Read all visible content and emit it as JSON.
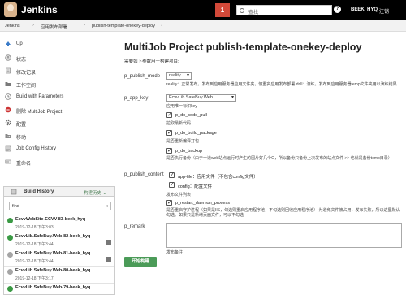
{
  "header": {
    "brand": "Jenkins",
    "notification_count": "1",
    "search_placeholder": "查找",
    "user": "BEEK_HYQ",
    "logout": "注销"
  },
  "breadcrumb": [
    "Jenkins",
    "应用发布部署",
    "publish-template-onekey-deploy"
  ],
  "sidebar": {
    "items": [
      {
        "label": "Up",
        "icon": "up-arrow-icon"
      },
      {
        "label": "状态",
        "icon": "status-icon"
      },
      {
        "label": "修改记录",
        "icon": "changes-icon"
      },
      {
        "label": "工作空间",
        "icon": "folder-icon"
      },
      {
        "label": "Build with Parameters",
        "icon": "build-clock-icon"
      },
      {
        "label": "删除 MultiJob Project",
        "icon": "delete-icon"
      },
      {
        "label": "配置",
        "icon": "gear-icon"
      },
      {
        "label": "移动",
        "icon": "move-icon"
      },
      {
        "label": "Job Config History",
        "icon": "history-icon"
      },
      {
        "label": "重命名",
        "icon": "rename-icon"
      }
    ]
  },
  "build_history": {
    "title": "Build History",
    "trend": "构建历史 ⌄",
    "filter_value": "find",
    "clear": "x",
    "builds": [
      {
        "name": "EcvvWebSite-ECVV-83-beek_hyq",
        "time": "2019-12-18 下午3:03",
        "status": "ok"
      },
      {
        "name": "EcvvLib.SafeBuy.Web-82-beek_hyq",
        "time": "2019-12-18 下午3:44",
        "status": "ok"
      },
      {
        "name": "EcvvLib.SafeBuy.Web-81-beek_hyq",
        "time": "2019-12-18 下午3:44",
        "status": "grey"
      },
      {
        "name": "EcvvLib.SafeBuy.Web-80-beek_hyq",
        "time": "2019-12-18 下午3:17",
        "status": "grey"
      },
      {
        "name": "EcvvLib.SafeBuy.Web-79-beek_hyq",
        "time": "",
        "status": "ok"
      }
    ]
  },
  "main": {
    "title": "MultiJob Project publish-template-onekey-deploy",
    "intro": "需要如下参数用于构建项目:",
    "publish_mode": {
      "label": "p_publish_mode",
      "value": "reality",
      "desc": "reality：正常发布。发布到应用服务器应用文件夹，慎重实应用发布部署 drill：演练。发布到应用服务器temp文件夹用以演练结果"
    },
    "app_key": {
      "label": "p_app_key",
      "value": "EcvvLib.SafeBuy.Web",
      "desc": "应用唯一标识key"
    },
    "checks": [
      {
        "name": "p_do_code_pull",
        "desc": "拉取最新代码",
        "checked": true
      },
      {
        "name": "p_do_build_package",
        "desc": "是否重新编译打包",
        "checked": true
      },
      {
        "name": "p_do_backup",
        "desc": "是否执行备份（由于一道web站点运行时产生的图片好几个G，所以备份只备份上次发布的站点文件 >> 也就是备份temp目录）",
        "checked": true
      }
    ],
    "publish_content": {
      "label": "p_publish_content",
      "options": [
        {
          "text": "app-file：应用文件（不包含config文件）",
          "checked": true
        },
        {
          "text": "config：配置文件",
          "checked": true
        }
      ],
      "desc": "发布文件列表"
    },
    "restart": {
      "name": "p_restart_daemon_process",
      "desc": "是否重启守护进程（如果是IIS，勾选则重启应用程序池，不勾选则回收应用程序池） 为避免文件被占用，发布失败，所以这里默认勾选。如果只是新增页面文件，可以不勾选",
      "checked": true
    },
    "remark": {
      "label": "p_remark",
      "desc": "发布备注"
    },
    "submit": "开始构建"
  }
}
